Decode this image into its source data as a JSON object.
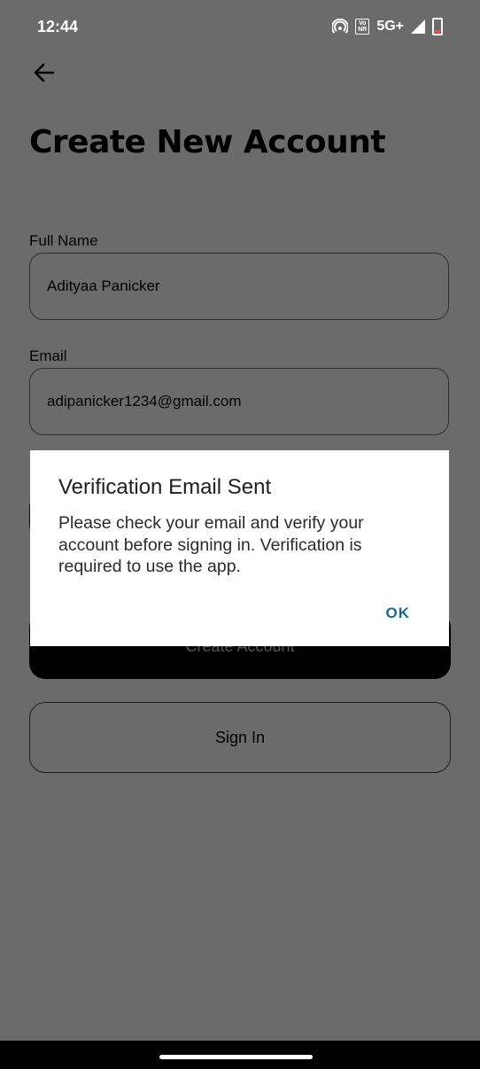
{
  "status_bar": {
    "time": "12:44",
    "volte": "Vo\nNR",
    "network": "5G+"
  },
  "header": {
    "title": "Create New Account"
  },
  "form": {
    "full_name_label": "Full Name",
    "full_name_value": "Adityaa Panicker",
    "email_label": "Email",
    "email_value": "adipanicker1234@gmail.com",
    "create_button_label": "Create Account",
    "signin_button_label": "Sign In"
  },
  "dialog": {
    "title": "Verification Email Sent",
    "message": "Please check your email and verify your account before signing in. Verification is required to use the app.",
    "ok_label": "OK"
  },
  "colors": {
    "scrim": "#6b6b6b",
    "dialog_bg": "#ffffff",
    "ok_text": "#1a6b8a",
    "battery_low": "#ff4a4a"
  }
}
